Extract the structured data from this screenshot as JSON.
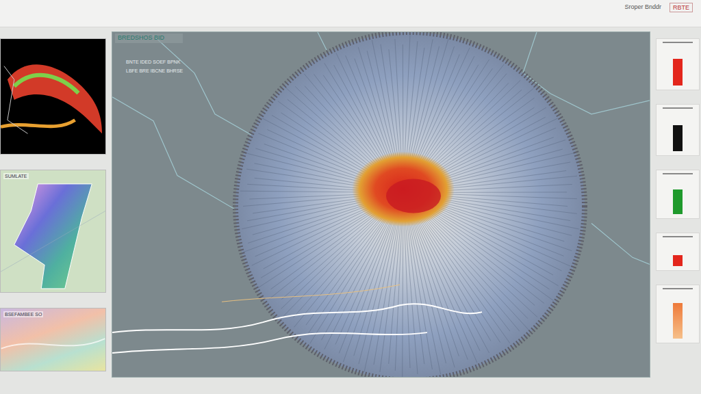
{
  "header": {
    "title": "RBTE",
    "subtitle": "Sroper Bnddr"
  },
  "canvas": {
    "label": "BREDSHOS BID",
    "lines": [
      "BNTE IDED SOEF BPNK",
      "LBFE BRE IBCNE BHRSE"
    ]
  },
  "thumbnails": [
    {
      "caption": ""
    },
    {
      "caption": "SUMLATE"
    },
    {
      "caption": "BSEFAMBEE SO"
    }
  ],
  "meters": [
    {
      "level": 0.68,
      "color": "#e3261c"
    },
    {
      "level": 0.66,
      "color": "#111111"
    },
    {
      "level": 0.68,
      "color": "#1f9a2c"
    },
    {
      "level": 0.42,
      "color": "#e3261c"
    },
    {
      "level": 0.78,
      "color": "#ee7a3a"
    }
  ]
}
